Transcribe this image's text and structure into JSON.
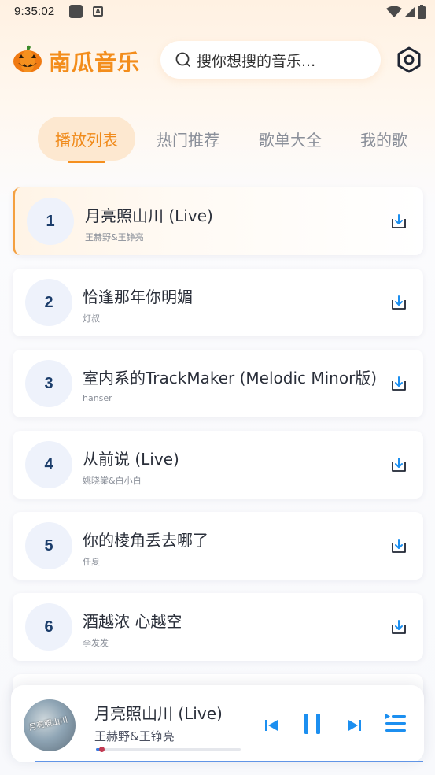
{
  "status_bar": {
    "time": "9:35:02",
    "a_badge": "A"
  },
  "header": {
    "title": "南瓜音乐",
    "search_placeholder": "搜你想搜的音乐..."
  },
  "tabs": [
    {
      "label": "播放列表",
      "active": true
    },
    {
      "label": "热门推荐",
      "active": false
    },
    {
      "label": "歌单大全",
      "active": false
    },
    {
      "label": "我的歌",
      "active": false
    }
  ],
  "songs": [
    {
      "num": "1",
      "title": "月亮照山川 (Live)",
      "artist": "王赫野&王铮亮",
      "current": true
    },
    {
      "num": "2",
      "title": "恰逢那年你明媚",
      "artist": "灯叔",
      "current": false
    },
    {
      "num": "3",
      "title": "室内系的TrackMaker (Melodic Minor版)",
      "artist": "hanser",
      "current": false
    },
    {
      "num": "4",
      "title": "从前说 (Live)",
      "artist": "姚晓棠&白小白",
      "current": false
    },
    {
      "num": "5",
      "title": "你的棱角丢去哪了",
      "artist": "任夏",
      "current": false
    },
    {
      "num": "6",
      "title": "酒越浓 心越空",
      "artist": "李发发",
      "current": false
    }
  ],
  "player": {
    "title": "月亮照山川 (Live)",
    "artist": "王赫野&王铮亮",
    "album_art_text": "月亮照山川",
    "progress": 0.04
  },
  "colors": {
    "brand": "#f38d1c",
    "accent_blue": "#1c8ff0",
    "number_text": "#1b3d6b"
  }
}
